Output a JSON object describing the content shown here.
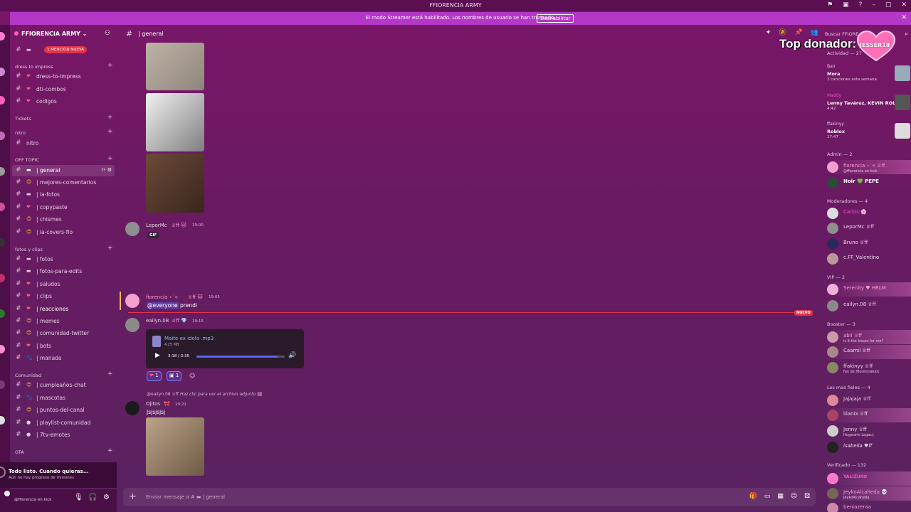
{
  "window": {
    "title": "FFIORENCIA ARMY"
  },
  "banner": {
    "text": "El modo Streamer está habilitado. Los nombres de usuario se han truncado.",
    "button": "Deshabilitar"
  },
  "server": {
    "name": "FFIORENCIA ARMY"
  },
  "sidebar": {
    "mention_pill": "1 MENCIÓN NUEVA",
    "categories": [
      {
        "label": "dress to impress"
      },
      {
        "label": "Tickets"
      },
      {
        "label": "nitro"
      },
      {
        "label": "OFF TOPIC"
      },
      {
        "label": "fotos y clips"
      },
      {
        "label": "Comunidad"
      },
      {
        "label": "GTA"
      }
    ],
    "channels": [
      {
        "emoji": "❤",
        "label": "dress-to-impress"
      },
      {
        "emoji": "❤",
        "label": "dti-combos"
      },
      {
        "emoji": "❤",
        "label": "codigos"
      },
      {
        "emoji": "",
        "label": "nitro"
      },
      {
        "emoji": "▬",
        "label": "| general"
      },
      {
        "emoji": "😊",
        "label": "| mejores-comentarios"
      },
      {
        "emoji": "▬",
        "label": "| ia-fotos"
      },
      {
        "emoji": "❤",
        "label": "| copypaste"
      },
      {
        "emoji": "😊",
        "label": "| chismes"
      },
      {
        "emoji": "😊",
        "label": "| ia-covers-fio"
      },
      {
        "emoji": "▬",
        "label": "| fotos"
      },
      {
        "emoji": "▬",
        "label": "| fotos-para-edits"
      },
      {
        "emoji": "❤",
        "label": "| saludos"
      },
      {
        "emoji": "❤",
        "label": "| clips"
      },
      {
        "emoji": "❤",
        "label": "| reacciones"
      },
      {
        "emoji": "😊",
        "label": "| memes"
      },
      {
        "emoji": "😊",
        "label": "| comunidad-twitter"
      },
      {
        "emoji": "❤",
        "label": "| bots"
      },
      {
        "emoji": "🐾",
        "label": "| manada"
      },
      {
        "emoji": "😊",
        "label": "| cumpleaños-chat"
      },
      {
        "emoji": "🐾",
        "label": "| mascotas"
      },
      {
        "emoji": "😊",
        "label": "| puntos-del-canal"
      },
      {
        "emoji": "●",
        "label": "| playlist-comunidad"
      },
      {
        "emoji": "●",
        "label": "| 7tv-emotes"
      }
    ]
  },
  "quest": {
    "title": "Todo listo. Cuando quieras...",
    "subtitle": "Aún no hay progreso de misiones"
  },
  "user_panel": {
    "status": "@ffiorencia en kick"
  },
  "header": {
    "channel": "| general",
    "search": "Buscar FFIORE"
  },
  "overlay": {
    "top_donor_label": "Top donador:",
    "top_donor_name": "JESSER18"
  },
  "messages": [
    {
      "author": "LeporMc",
      "badges": "♕ff 🐱",
      "time": "19:00",
      "tag": "GIF"
    },
    {
      "author": "fiorencia ⋆˙⟡",
      "badges": "♕ff 🐱",
      "time": "19:05",
      "mention": "@everyone",
      "text": " prendi"
    },
    {
      "author": "eailyn.08",
      "badges": "♕ff 💎",
      "time": "19:15"
    },
    {
      "reply_author": "@eailyn.08",
      "reply_text": "Haz clic para ver el archivo adjunto",
      "author": "Ojitos",
      "badges": "🎀",
      "time": "19:21",
      "text": "Jsjsjsjsj"
    }
  ],
  "new_label": "NUEVO",
  "audio": {
    "filename": "Maite ex idola .mp3",
    "size": "4.25 MB",
    "time": "3:18 / 3:35",
    "progress": 0.92
  },
  "reactions": [
    {
      "emoji": "❤",
      "count": "1"
    },
    {
      "emoji": "▣",
      "count": "1"
    }
  ],
  "composer": {
    "placeholder": "Enviar mensaje a # ▬ | general"
  },
  "activity": {
    "header": "Actividad — 27",
    "items": [
      {
        "who": "Bair",
        "title": "Mora",
        "sub": "3 canciones esta semana"
      },
      {
        "who": "Maddy",
        "title": "Lenny Tavárez, KEVIN ROL...",
        "sub": "4:42"
      },
      {
        "who": "ffakinyy",
        "title": "Roblox",
        "sub": "17:47"
      }
    ]
  },
  "member_groups": [
    {
      "label": "Admin — 2",
      "members": [
        {
          "name": "fiorencia ⋆˙⟡ ♕ff",
          "sub": "@ffiorencia en kick",
          "color": "#ff9ad5"
        },
        {
          "name": "Noir 💚 PEPE",
          "sub": "",
          "color": "#ffffff"
        }
      ]
    },
    {
      "label": "Moderadores — 4",
      "members": [
        {
          "name": "Carlos 🌸",
          "sub": "",
          "color": "#ff4fd0"
        },
        {
          "name": "LeporMc ♕ff",
          "sub": "",
          "color": "#e8d6e6"
        },
        {
          "name": "Bruno ♕ff",
          "sub": "",
          "color": "#e8d6e6"
        },
        {
          "name": "c.FF_Valentino",
          "sub": "",
          "color": "#e8d6e6"
        }
      ]
    },
    {
      "label": "VIP — 2",
      "members": [
        {
          "name": "Serenity ♥ HRLM",
          "sub": "",
          "color": "#ff9ad5"
        },
        {
          "name": "eailyn.08 ♕ff",
          "sub": "",
          "color": "#e8d6e6"
        }
      ]
    },
    {
      "label": "Booster — 3",
      "members": [
        {
          "name": "abii ♕ff",
          "sub": "is it the kisses for me?",
          "color": "#ff9ad5"
        },
        {
          "name": "Caamii ♕ff",
          "sub": "",
          "color": "#e8d6e6"
        },
        {
          "name": "ffakinyy ♕ff",
          "sub": "fan de ffiorenciakick",
          "color": "#e8d6e6"
        }
      ]
    },
    {
      "label": "Los mas fieles — 4",
      "members": [
        {
          "name": "Jajajaja ♕ff",
          "sub": "",
          "color": "#e8d6e6"
        },
        {
          "name": "lilanix ♕ff",
          "sub": "",
          "color": "#e8d6e6"
        },
        {
          "name": "Jenny ♕ff",
          "sub": "Hogwarts Legacy",
          "color": "#e8d6e6"
        },
        {
          "name": "isabella ♥ff",
          "sub": "",
          "color": "#e8d6e6"
        }
      ]
    },
    {
      "label": "Verificado — 132",
      "members": [
        {
          "name": "YALIZUKO",
          "sub": "",
          "color": "#ff4fd0"
        },
        {
          "name": "JeykoAlcaheda 💀",
          "sub": "JeykoAlcaheda",
          "color": "#ff9ad5"
        },
        {
          "name": "beniazeraa",
          "sub": "",
          "color": "#ff9ad5"
        }
      ]
    }
  ],
  "colors": {
    "accent": "#b437c7",
    "new": "#e0334a",
    "link": "#8ab4ff"
  }
}
